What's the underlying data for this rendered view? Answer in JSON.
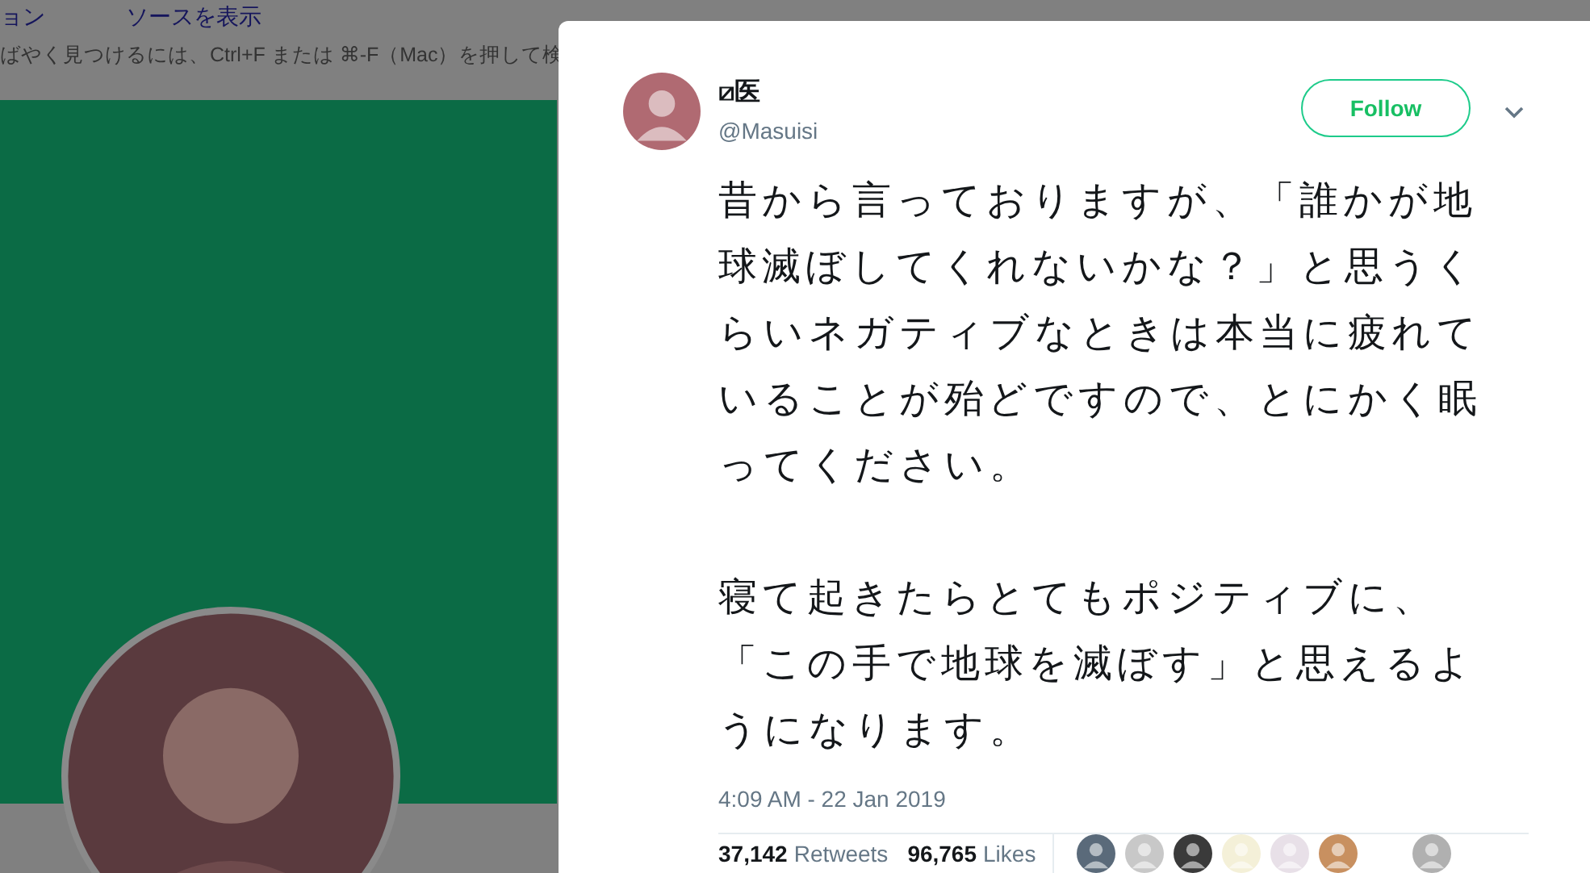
{
  "background_page": {
    "links": [
      "ョン",
      "ソースを表示"
    ],
    "hint": "ばやく見つけるには、Ctrl+F または ⌘-F（Mac）を押して検"
  },
  "tweet": {
    "display_name": "⧄医",
    "handle": "@Masuisi",
    "follow_button": "Follow",
    "paragraphs": [
      "昔から言っておりますが、「誰かが地球滅ぼしてくれないかな？」と思うくらいネガティブなときは本当に疲れていることが殆どですので、とにかく眠ってください。",
      "寝て起きたらとてもポジティブに、「この手で地球を滅ぼす」と思えるようになります。"
    ],
    "timestamp": "4:09 AM - 22 Jan 2019",
    "stats": [
      {
        "count": "37,142",
        "label": "Retweets"
      },
      {
        "count": "96,765",
        "label": "Likes"
      }
    ],
    "liker_avatars": [
      {
        "color": "#5a6a7a"
      },
      {
        "color": "#c8c8c8"
      },
      {
        "color": "#3a3a3a"
      },
      {
        "color": "#f4f0d8"
      },
      {
        "color": "#e8e0e8"
      },
      {
        "color": "#c89060"
      },
      {
        "color": "#b0b0b0"
      }
    ]
  }
}
